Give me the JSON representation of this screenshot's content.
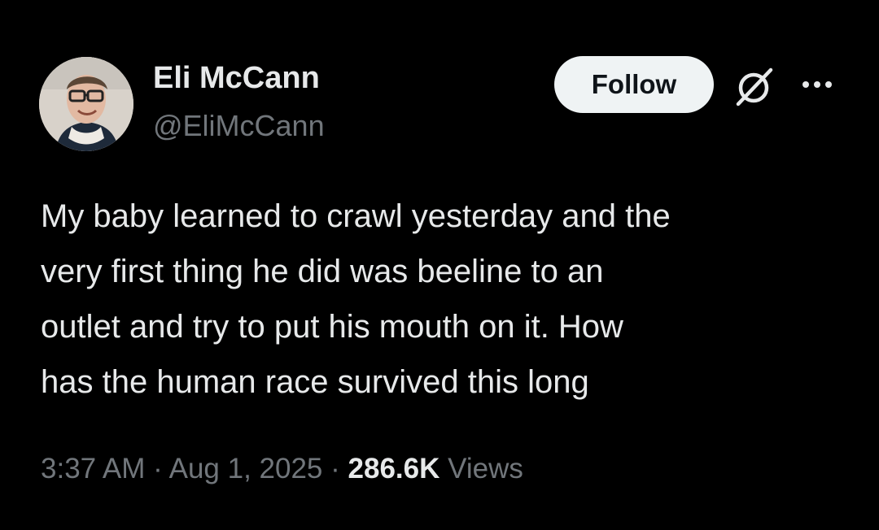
{
  "author": {
    "display_name": "Eli McCann",
    "handle": "@EliMcCann",
    "avatar_icon": "user-avatar"
  },
  "actions": {
    "follow_label": "Follow",
    "grok_icon": "grok-icon",
    "more_icon": "more-horizontal-icon"
  },
  "tweet": {
    "lines": [
      "My baby learned to crawl yesterday and the",
      "very first thing he did was beeline to an",
      "outlet and try to put his mouth on it. How",
      "has the human race survived this long"
    ]
  },
  "meta": {
    "time": "3:37 AM",
    "separator": "·",
    "date": "Aug 1, 2025",
    "views_count": "286.6K",
    "views_label": "Views"
  },
  "colors": {
    "background": "#000000",
    "primary_text": "#e7e9ea",
    "secondary_text": "#71767b",
    "button_bg": "#eff3f4",
    "button_text": "#0f1419"
  }
}
